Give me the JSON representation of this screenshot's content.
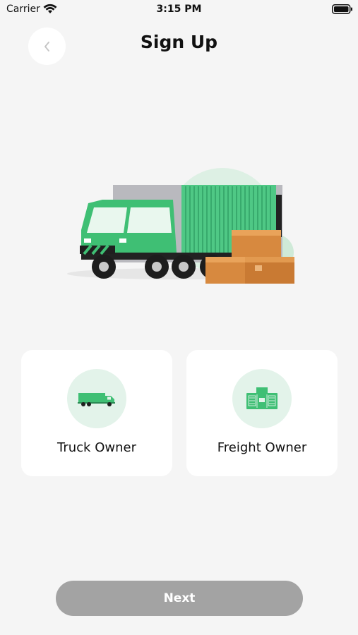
{
  "status_bar": {
    "carrier": "Carrier",
    "time": "3:15 PM"
  },
  "header": {
    "title": "Sign Up",
    "back_icon": "chevron-left-icon"
  },
  "hero": {
    "illustration": "truck-with-boxes-illustration"
  },
  "roles": [
    {
      "label": "Truck Owner",
      "icon": "truck-icon"
    },
    {
      "label": "Freight Owner",
      "icon": "freight-icon"
    }
  ],
  "footer": {
    "next_label": "Next"
  },
  "colors": {
    "background": "#f5f5f5",
    "accent_green": "#3fbf74",
    "icon_circle": "#e3f3ea",
    "button_disabled": "#a3a3a3"
  }
}
